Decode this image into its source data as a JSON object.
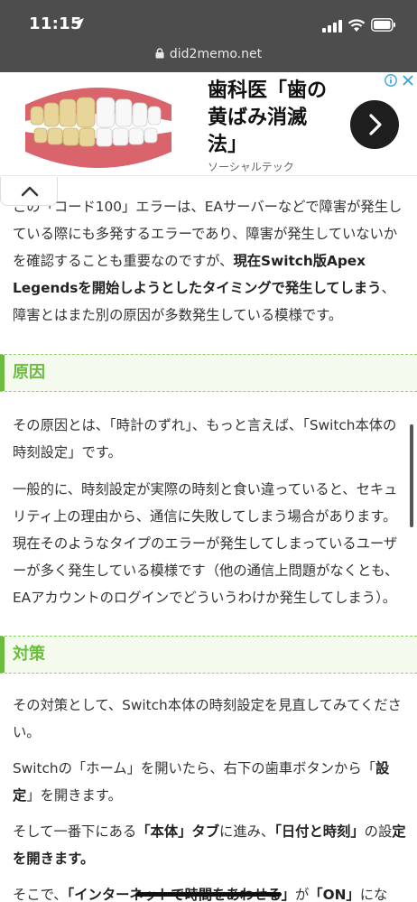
{
  "status": {
    "time": "11:15"
  },
  "browser": {
    "url": "did2memo.net"
  },
  "ad": {
    "title": "歯科医「歯の黄ばみ消滅法」",
    "source": "ソーシャルテック",
    "icons": [
      "info-icon",
      "close-icon",
      "chevron-right-icon"
    ]
  },
  "article": {
    "intro": {
      "t1": "この「コード100」エラーは、EAサーバーなどで障害が発生している際にも多発するエラーであり、障害が発生していないかを確認することも重要なのですが、",
      "b1": "現在Switch版Apex Legendsを開始しようとしたタイミングで発生してしまう",
      "t2": "、障害とはまた別の原因が多数発生している模様です。"
    },
    "section1": {
      "heading": "原因",
      "p1": "その原因とは、「時計のずれ」、もっと言えば、「Switch本体の時刻設定」です。",
      "p2": "一般的に、時刻設定が実際の時刻と食い違っていると、セキュリティ上の理由から、通信に失敗してしまう場合があります。現在そのようなタイプのエラーが発生してしまっているユーザーが多く発生している模様です（他の通信上問題がなくとも、EAアカウントのログインでどういうわけか発生してしまう）。"
    },
    "section2": {
      "heading": "対策",
      "p1": "その対策として、Switch本体の時刻設定を見直してみてください。",
      "p2_t1": "Switchの「ホーム」を開いたら、右下の歯車ボタンから「",
      "p2_b1": "設定",
      "p2_t2": "」を開きます。",
      "p3_t1": "そして一番下にある",
      "p3_b1": "「本体」タブ",
      "p3_t2": "に進み、",
      "p3_b2": "「日付と時刻」",
      "p3_t3": "の設",
      "p3_b3": "定を開きます。",
      "p4_t1": "そこで、",
      "p4_b1": "「インターネットで時間をあわせる」",
      "p4_t2": "が",
      "p4_b2": "「ON」",
      "p4_t3": "にな"
    }
  }
}
